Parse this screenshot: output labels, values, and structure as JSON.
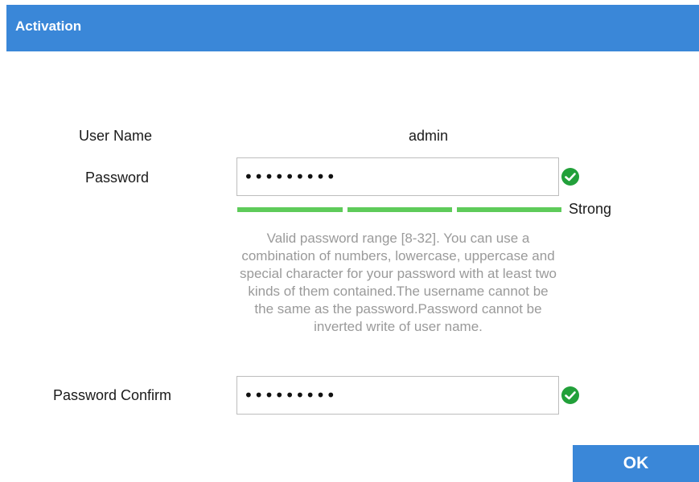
{
  "dialog": {
    "title": "Activation"
  },
  "form": {
    "username_label": "User Name",
    "username_value": "admin",
    "password_label": "Password",
    "password_value": "•••••••••",
    "password_strength": "Strong",
    "password_strength_level": 3,
    "password_strength_max": 3,
    "hint": "Valid password range [8-32]. You can use a combination of numbers, lowercase, uppercase and special character for your password with at least two kinds of them contained.The username cannot be the same as the password.Password cannot be inverted write of user name.",
    "confirm_label": "Password Confirm",
    "confirm_value": "•••••••••"
  },
  "actions": {
    "ok_label": "OK"
  },
  "colors": {
    "accent": "#3a87d8",
    "strength_bar": "#5ecb5a",
    "valid_icon": "#22a03a"
  },
  "icons": {
    "password_status": "check-circle-icon",
    "confirm_status": "check-circle-icon"
  }
}
